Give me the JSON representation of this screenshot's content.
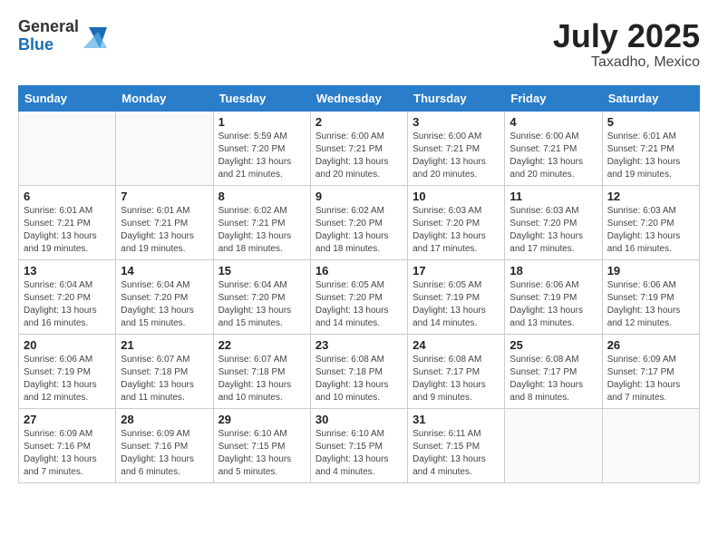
{
  "header": {
    "logo_general": "General",
    "logo_blue": "Blue",
    "month": "July 2025",
    "location": "Taxadho, Mexico"
  },
  "weekdays": [
    "Sunday",
    "Monday",
    "Tuesday",
    "Wednesday",
    "Thursday",
    "Friday",
    "Saturday"
  ],
  "weeks": [
    [
      {
        "day": "",
        "info": ""
      },
      {
        "day": "",
        "info": ""
      },
      {
        "day": "1",
        "info": "Sunrise: 5:59 AM\nSunset: 7:20 PM\nDaylight: 13 hours and 21 minutes."
      },
      {
        "day": "2",
        "info": "Sunrise: 6:00 AM\nSunset: 7:21 PM\nDaylight: 13 hours and 20 minutes."
      },
      {
        "day": "3",
        "info": "Sunrise: 6:00 AM\nSunset: 7:21 PM\nDaylight: 13 hours and 20 minutes."
      },
      {
        "day": "4",
        "info": "Sunrise: 6:00 AM\nSunset: 7:21 PM\nDaylight: 13 hours and 20 minutes."
      },
      {
        "day": "5",
        "info": "Sunrise: 6:01 AM\nSunset: 7:21 PM\nDaylight: 13 hours and 19 minutes."
      }
    ],
    [
      {
        "day": "6",
        "info": "Sunrise: 6:01 AM\nSunset: 7:21 PM\nDaylight: 13 hours and 19 minutes."
      },
      {
        "day": "7",
        "info": "Sunrise: 6:01 AM\nSunset: 7:21 PM\nDaylight: 13 hours and 19 minutes."
      },
      {
        "day": "8",
        "info": "Sunrise: 6:02 AM\nSunset: 7:21 PM\nDaylight: 13 hours and 18 minutes."
      },
      {
        "day": "9",
        "info": "Sunrise: 6:02 AM\nSunset: 7:20 PM\nDaylight: 13 hours and 18 minutes."
      },
      {
        "day": "10",
        "info": "Sunrise: 6:03 AM\nSunset: 7:20 PM\nDaylight: 13 hours and 17 minutes."
      },
      {
        "day": "11",
        "info": "Sunrise: 6:03 AM\nSunset: 7:20 PM\nDaylight: 13 hours and 17 minutes."
      },
      {
        "day": "12",
        "info": "Sunrise: 6:03 AM\nSunset: 7:20 PM\nDaylight: 13 hours and 16 minutes."
      }
    ],
    [
      {
        "day": "13",
        "info": "Sunrise: 6:04 AM\nSunset: 7:20 PM\nDaylight: 13 hours and 16 minutes."
      },
      {
        "day": "14",
        "info": "Sunrise: 6:04 AM\nSunset: 7:20 PM\nDaylight: 13 hours and 15 minutes."
      },
      {
        "day": "15",
        "info": "Sunrise: 6:04 AM\nSunset: 7:20 PM\nDaylight: 13 hours and 15 minutes."
      },
      {
        "day": "16",
        "info": "Sunrise: 6:05 AM\nSunset: 7:20 PM\nDaylight: 13 hours and 14 minutes."
      },
      {
        "day": "17",
        "info": "Sunrise: 6:05 AM\nSunset: 7:19 PM\nDaylight: 13 hours and 14 minutes."
      },
      {
        "day": "18",
        "info": "Sunrise: 6:06 AM\nSunset: 7:19 PM\nDaylight: 13 hours and 13 minutes."
      },
      {
        "day": "19",
        "info": "Sunrise: 6:06 AM\nSunset: 7:19 PM\nDaylight: 13 hours and 12 minutes."
      }
    ],
    [
      {
        "day": "20",
        "info": "Sunrise: 6:06 AM\nSunset: 7:19 PM\nDaylight: 13 hours and 12 minutes."
      },
      {
        "day": "21",
        "info": "Sunrise: 6:07 AM\nSunset: 7:18 PM\nDaylight: 13 hours and 11 minutes."
      },
      {
        "day": "22",
        "info": "Sunrise: 6:07 AM\nSunset: 7:18 PM\nDaylight: 13 hours and 10 minutes."
      },
      {
        "day": "23",
        "info": "Sunrise: 6:08 AM\nSunset: 7:18 PM\nDaylight: 13 hours and 10 minutes."
      },
      {
        "day": "24",
        "info": "Sunrise: 6:08 AM\nSunset: 7:17 PM\nDaylight: 13 hours and 9 minutes."
      },
      {
        "day": "25",
        "info": "Sunrise: 6:08 AM\nSunset: 7:17 PM\nDaylight: 13 hours and 8 minutes."
      },
      {
        "day": "26",
        "info": "Sunrise: 6:09 AM\nSunset: 7:17 PM\nDaylight: 13 hours and 7 minutes."
      }
    ],
    [
      {
        "day": "27",
        "info": "Sunrise: 6:09 AM\nSunset: 7:16 PM\nDaylight: 13 hours and 7 minutes."
      },
      {
        "day": "28",
        "info": "Sunrise: 6:09 AM\nSunset: 7:16 PM\nDaylight: 13 hours and 6 minutes."
      },
      {
        "day": "29",
        "info": "Sunrise: 6:10 AM\nSunset: 7:15 PM\nDaylight: 13 hours and 5 minutes."
      },
      {
        "day": "30",
        "info": "Sunrise: 6:10 AM\nSunset: 7:15 PM\nDaylight: 13 hours and 4 minutes."
      },
      {
        "day": "31",
        "info": "Sunrise: 6:11 AM\nSunset: 7:15 PM\nDaylight: 13 hours and 4 minutes."
      },
      {
        "day": "",
        "info": ""
      },
      {
        "day": "",
        "info": ""
      }
    ]
  ]
}
